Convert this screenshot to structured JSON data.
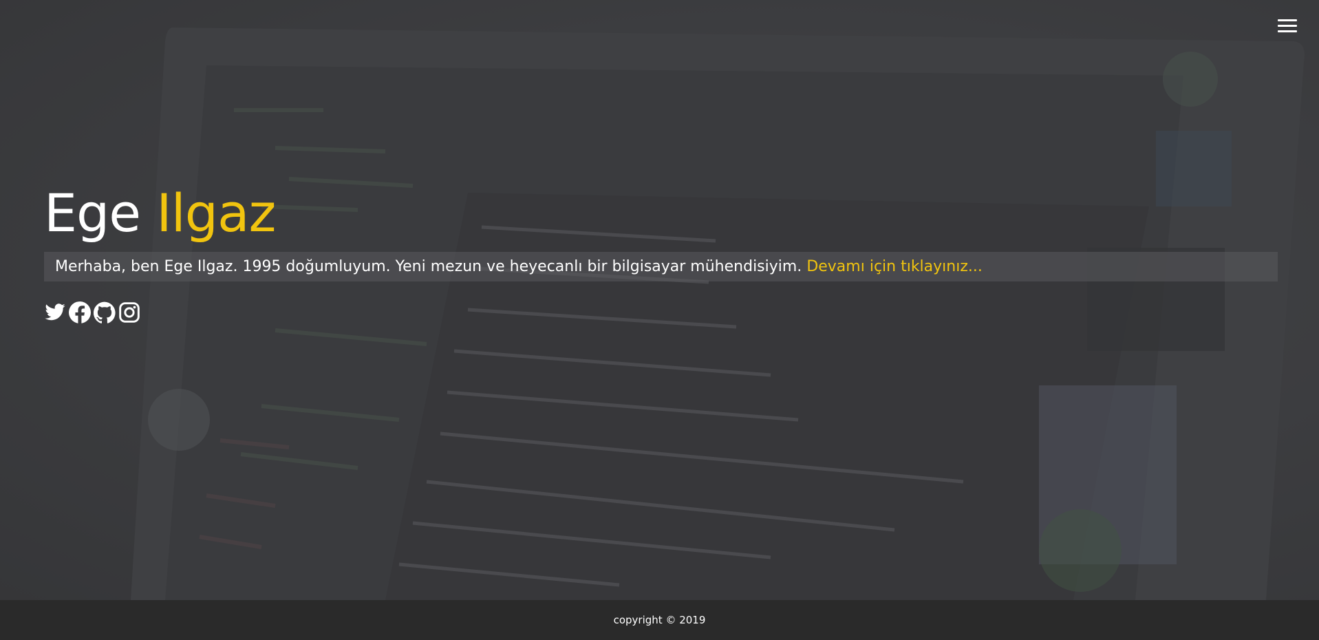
{
  "header": {
    "menu_icon": "hamburger-menu-icon"
  },
  "intro": {
    "first_name": "Ege",
    "last_name": "Ilgaz",
    "about_text": "Merhaba, ben Ege Ilgaz. 1995 doğumluyum. Yeni mezun ve heyecanlı bir bilgisayar mühendisiyim.",
    "about_link": "Devamı için tıklayınız...",
    "accent_color": "#f1c40f"
  },
  "socials": [
    {
      "name": "twitter",
      "icon": "twitter-icon"
    },
    {
      "name": "facebook",
      "icon": "facebook-icon"
    },
    {
      "name": "github",
      "icon": "github-icon"
    },
    {
      "name": "instagram",
      "icon": "instagram-icon"
    }
  ],
  "footer": {
    "copyright": "copyright © 2019"
  }
}
